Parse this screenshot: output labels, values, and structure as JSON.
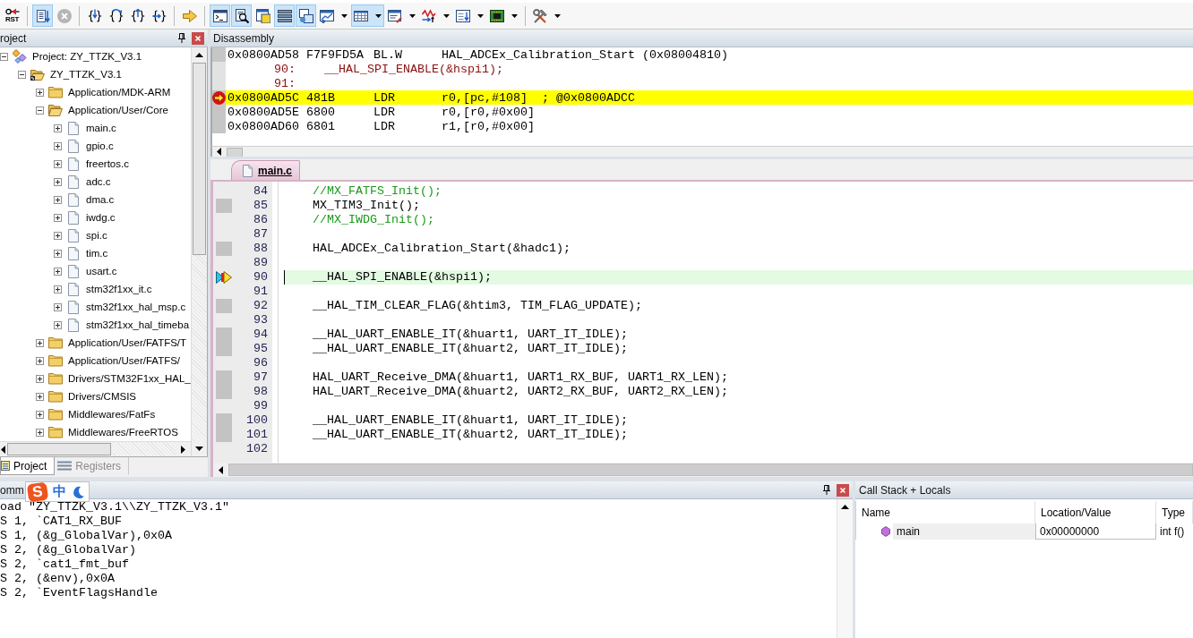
{
  "toolbar": {
    "groups": [
      [
        {
          "label": "RST",
          "pressed": false,
          "disabled": false,
          "menu": false
        }
      ],
      [
        {
          "pressed": true,
          "disabled": false,
          "menu": false
        },
        {
          "pressed": false,
          "disabled": true,
          "menu": false
        }
      ],
      [
        {
          "pressed": false,
          "disabled": false,
          "menu": false
        },
        {
          "pressed": false,
          "disabled": false,
          "menu": false
        },
        {
          "pressed": false,
          "disabled": false,
          "menu": false
        },
        {
          "pressed": false,
          "disabled": false,
          "menu": false
        }
      ],
      [
        {
          "pressed": false,
          "disabled": false,
          "menu": false
        }
      ],
      [
        {
          "pressed": true,
          "disabled": false,
          "menu": false
        },
        {
          "pressed": true,
          "disabled": false,
          "menu": false
        },
        {
          "pressed": false,
          "disabled": false,
          "menu": false
        },
        {
          "pressed": true,
          "disabled": false,
          "menu": false
        },
        {
          "pressed": true,
          "disabled": false,
          "menu": false
        },
        {
          "pressed": false,
          "disabled": false,
          "menu": true
        },
        {
          "pressed": true,
          "disabled": false,
          "menu": true
        },
        {
          "pressed": false,
          "disabled": false,
          "menu": true
        },
        {
          "pressed": false,
          "disabled": false,
          "menu": true
        },
        {
          "pressed": false,
          "disabled": false,
          "menu": true
        },
        {
          "pressed": false,
          "disabled": false,
          "menu": true
        }
      ],
      [
        {
          "pressed": false,
          "disabled": false,
          "menu": true
        }
      ]
    ]
  },
  "project_panel": {
    "title": "roject",
    "tree": [
      {
        "kind": "project",
        "label": "Project: ZY_TTZK_V3.1",
        "expanded": true,
        "children": [
          {
            "kind": "target",
            "label": "ZY_TTZK_V3.1",
            "expanded": true,
            "children": [
              {
                "kind": "group",
                "label": "Application/MDK-ARM",
                "expanded": false
              },
              {
                "kind": "group",
                "label": "Application/User/Core",
                "expanded": true,
                "children": [
                  {
                    "kind": "file",
                    "label": "main.c",
                    "expanded": false
                  },
                  {
                    "kind": "file",
                    "label": "gpio.c",
                    "expanded": false
                  },
                  {
                    "kind": "file",
                    "label": "freertos.c",
                    "expanded": false
                  },
                  {
                    "kind": "file",
                    "label": "adc.c",
                    "expanded": false
                  },
                  {
                    "kind": "file",
                    "label": "dma.c",
                    "expanded": false
                  },
                  {
                    "kind": "file",
                    "label": "iwdg.c",
                    "expanded": false
                  },
                  {
                    "kind": "file",
                    "label": "spi.c",
                    "expanded": false
                  },
                  {
                    "kind": "file",
                    "label": "tim.c",
                    "expanded": false
                  },
                  {
                    "kind": "file",
                    "label": "usart.c",
                    "expanded": false
                  },
                  {
                    "kind": "file",
                    "label": "stm32f1xx_it.c",
                    "expanded": false
                  },
                  {
                    "kind": "file",
                    "label": "stm32f1xx_hal_msp.c",
                    "expanded": false
                  },
                  {
                    "kind": "file",
                    "label": "stm32f1xx_hal_timeba",
                    "expanded": false
                  }
                ]
              },
              {
                "kind": "group",
                "label": "Application/User/FATFS/T",
                "expanded": false
              },
              {
                "kind": "group",
                "label": "Application/User/FATFS/",
                "expanded": false
              },
              {
                "kind": "group",
                "label": "Drivers/STM32F1xx_HAL_",
                "expanded": false
              },
              {
                "kind": "group",
                "label": "Drivers/CMSIS",
                "expanded": false
              },
              {
                "kind": "group",
                "label": "Middlewares/FatFs",
                "expanded": false
              },
              {
                "kind": "group",
                "label": "Middlewares/FreeRTOS",
                "expanded": false
              }
            ]
          }
        ]
      }
    ],
    "tabs": [
      {
        "label": "Project",
        "selected": true
      },
      {
        "label": "Registers",
        "selected": false
      }
    ]
  },
  "disassembly": {
    "title": "Disassembly",
    "rows": [
      {
        "kind": "instruction",
        "address": "0x0800AD58",
        "opcode": "F7F9FD5A",
        "mnemonic": "BL.W",
        "operands": "HAL_ADCEx_Calibration_Start (0x08004810)",
        "current": false
      },
      {
        "kind": "source",
        "line": "90:",
        "text": "__HAL_SPI_ENABLE(&hspi1);",
        "current": false
      },
      {
        "kind": "source",
        "line": "91:",
        "current": false
      },
      {
        "kind": "instruction",
        "address": "0x0800AD5C",
        "opcode": "481B",
        "mnemonic": "LDR",
        "operands": "r0,[pc,#108]",
        "comment": "; @0x0800ADCC",
        "current": true
      },
      {
        "kind": "instruction",
        "address": "0x0800AD5E",
        "opcode": "6800",
        "mnemonic": "LDR",
        "operands": "r0,[r0,#0x00]",
        "current": false
      },
      {
        "kind": "instruction",
        "address": "0x0800AD60",
        "opcode": "6801",
        "mnemonic": "LDR",
        "operands": "r1,[r0,#0x00]",
        "current": false
      }
    ]
  },
  "editor": {
    "tabs": [
      {
        "label": "main.c",
        "selected": true
      }
    ],
    "lines": [
      {
        "number": "84",
        "kind": "comment",
        "text": "//MX_FATFS_Init();",
        "executable": false,
        "current": false
      },
      {
        "number": "85",
        "kind": "code",
        "text": "MX_TIM3_Init();",
        "executable": true,
        "current": false
      },
      {
        "number": "86",
        "kind": "comment",
        "text": "//MX_IWDG_Init();",
        "executable": false,
        "current": false
      },
      {
        "number": "87",
        "kind": "blank",
        "executable": false,
        "current": false
      },
      {
        "number": "88",
        "kind": "code",
        "text": "HAL_ADCEx_Calibration_Start(&hadc1);",
        "executable": true,
        "current": false
      },
      {
        "number": "89",
        "kind": "blank",
        "executable": false,
        "current": false
      },
      {
        "number": "90",
        "kind": "code",
        "text": "__HAL_SPI_ENABLE(&hspi1);",
        "executable": false,
        "current": true
      },
      {
        "number": "91",
        "kind": "blank",
        "executable": false,
        "current": false
      },
      {
        "number": "92",
        "kind": "code",
        "text": "__HAL_TIM_CLEAR_FLAG(&htim3, TIM_FLAG_UPDATE);",
        "executable": true,
        "current": false
      },
      {
        "number": "93",
        "kind": "blank",
        "executable": false,
        "current": false
      },
      {
        "number": "94",
        "kind": "code",
        "text": "__HAL_UART_ENABLE_IT(&huart1, UART_IT_IDLE);",
        "executable": true,
        "current": false
      },
      {
        "number": "95",
        "kind": "code",
        "text": "__HAL_UART_ENABLE_IT(&huart2, UART_IT_IDLE);",
        "executable": true,
        "current": false
      },
      {
        "number": "96",
        "kind": "blank",
        "executable": false,
        "current": false
      },
      {
        "number": "97",
        "kind": "code",
        "text": "HAL_UART_Receive_DMA(&huart1, UART1_RX_BUF, UART1_RX_LEN);",
        "executable": true,
        "current": false
      },
      {
        "number": "98",
        "kind": "code",
        "text": "HAL_UART_Receive_DMA(&huart2, UART2_RX_BUF, UART2_RX_LEN);",
        "executable": true,
        "current": false
      },
      {
        "number": "99",
        "kind": "blank",
        "executable": false,
        "current": false
      },
      {
        "number": "100",
        "kind": "code",
        "text": "__HAL_UART_ENABLE_IT(&huart1, UART_IT_IDLE);",
        "executable": true,
        "current": false
      },
      {
        "number": "101",
        "kind": "code",
        "text": "__HAL_UART_ENABLE_IT(&huart2, UART_IT_IDLE);",
        "executable": true,
        "current": false
      },
      {
        "number": "102",
        "kind": "blank",
        "executable": false,
        "current": false
      }
    ]
  },
  "command": {
    "title": "omm",
    "lines": [
      "oad \"ZY_TTZK_V3.1\\\\ZY_TTZK_V3.1\"",
      "S 1, `CAT1_RX_BUF",
      "S 1, (&g_GlobalVar),0x0A",
      "S 2, (&g_GlobalVar)",
      "S 2, `cat1_fmt_buf",
      "S 2, (&env),0x0A",
      "S 2, `EventFlagsHandle"
    ]
  },
  "ime_bar": {
    "logo": "S",
    "mode": "中"
  },
  "call_stack": {
    "title": "Call Stack + Locals",
    "columns": [
      "Name",
      "Location/Value",
      "Type"
    ],
    "rows": [
      {
        "name": "main",
        "location": "0x00000000",
        "type": "int f()"
      }
    ]
  }
}
